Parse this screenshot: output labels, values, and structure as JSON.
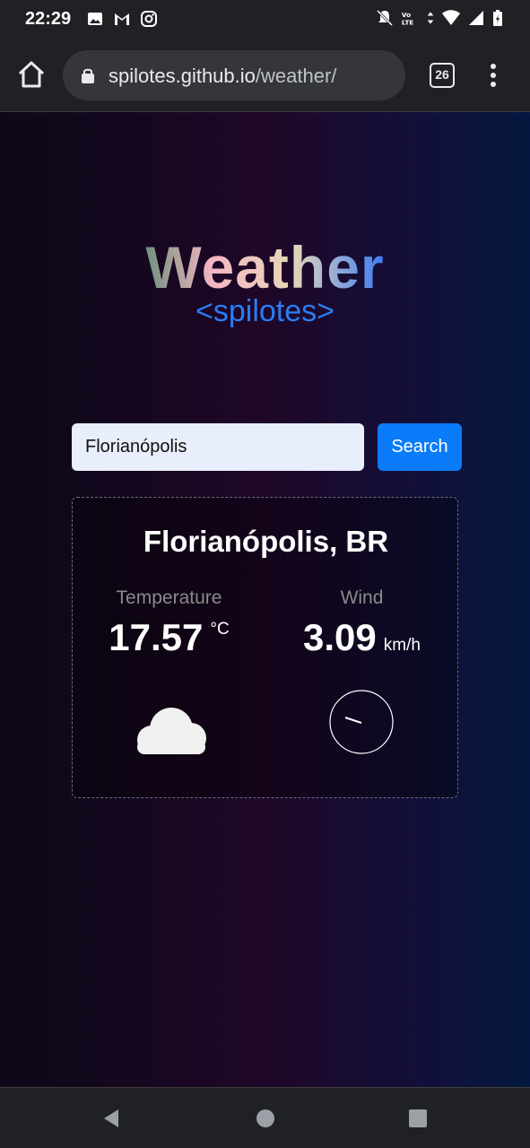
{
  "status_bar": {
    "time": "22:29",
    "left_icons": [
      "image-icon",
      "gmail-icon",
      "instagram-icon"
    ],
    "right_icons": [
      "mute-icon",
      "volte-icon",
      "data-arrows-icon",
      "wifi-icon",
      "signal-icon",
      "battery-icon"
    ]
  },
  "browser": {
    "url_host": "spilotes.github.io",
    "url_path": "/weather/",
    "tab_count": "26"
  },
  "app": {
    "title": "Weather",
    "subtitle": "<spilotes>",
    "search": {
      "value": "Florianópolis",
      "button_label": "Search"
    },
    "result": {
      "city": "Florianópolis, BR",
      "temperature_label": "Temperature",
      "temperature_value": "17.57",
      "temperature_unit": "°C",
      "wind_label": "Wind",
      "wind_value": "3.09",
      "wind_unit": "km/h",
      "weather_icon": "cloud-icon",
      "wind_direction_icon": "compass-icon"
    }
  },
  "colors": {
    "accent_blue": "#0a7cfa",
    "subtitle_blue": "#2a7df5"
  }
}
